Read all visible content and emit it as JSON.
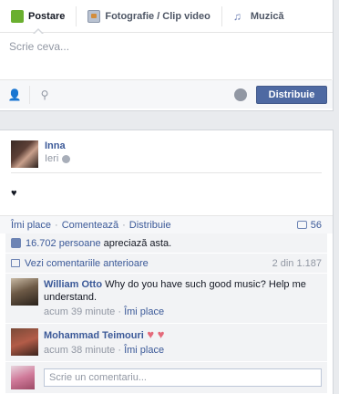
{
  "composer": {
    "tabs": [
      {
        "label": "Postare",
        "icon": "status-icon"
      },
      {
        "label": "Fotografie / Clip video",
        "icon": "photo-icon"
      },
      {
        "label": "Muzică",
        "icon": "music-icon"
      }
    ],
    "placeholder": "Scrie ceva...",
    "share_label": "Distribuie"
  },
  "post": {
    "author": "Inna",
    "time": "Ieri",
    "body": "♥",
    "actions": {
      "like": "Îmi place",
      "comment": "Comentează",
      "share": "Distribuie",
      "comment_count": "56"
    },
    "likes_text": {
      "count": "16.702 persoane",
      "suffix": " apreciază asta."
    },
    "view_previous": "Vezi comentariile anterioare",
    "comments_range": "2 din 1.187",
    "comments": [
      {
        "name": "William Otto",
        "text": " Why do you have such good music? Help me understand.",
        "time": "acum 39 minute",
        "like": "Îmi place"
      },
      {
        "name": "Mohammad Teimouri",
        "text": " ♥ ♥",
        "time": "acum 38 minute",
        "like": "Îmi place"
      }
    ],
    "reply_placeholder": "Scrie un comentariu..."
  }
}
